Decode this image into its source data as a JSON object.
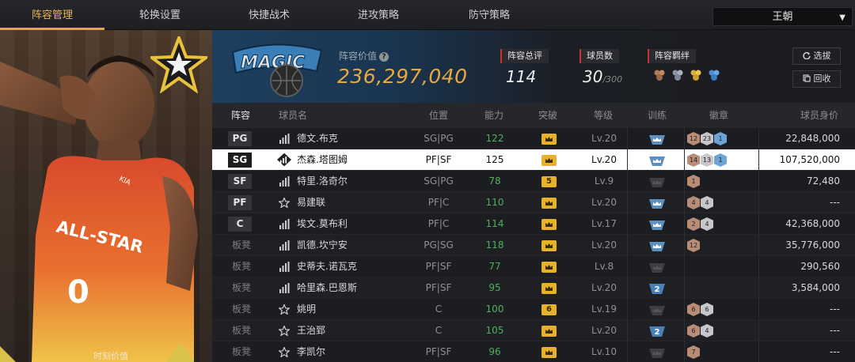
{
  "tabs": [
    {
      "label": "阵容管理",
      "active": true
    },
    {
      "label": "轮换设置",
      "active": false
    },
    {
      "label": "快捷战术",
      "active": false
    },
    {
      "label": "进攻策略",
      "active": false
    },
    {
      "label": "防守策略",
      "active": false
    }
  ],
  "team_select": {
    "value": "王朝"
  },
  "hero": {
    "caption": "时刻价值",
    "player_number": "0",
    "jersey_text": "ALL-STAR"
  },
  "team": {
    "logo_text": "MAGIC",
    "value_label": "阵容价值",
    "value": "236,297,040",
    "overall_label": "阵容总评",
    "overall": "114",
    "count_label": "球员数",
    "count": "30",
    "count_max": "/300",
    "bond_label": "阵容羁绊",
    "bond_icons": [
      "bond-bronze-icon",
      "bond-silver-icon",
      "bond-gold-icon",
      "bond-blue-icon"
    ]
  },
  "buttons": {
    "draft": "选拔",
    "recycle": "回收"
  },
  "columns": [
    "阵容",
    "球员名",
    "位置",
    "能力",
    "突破",
    "等级",
    "训练",
    "徽章",
    "球员身价"
  ],
  "rows": [
    {
      "slot": "PG",
      "starter": true,
      "rank": "bars",
      "name": "德文.布克",
      "pos": "SG|PG",
      "ability": "122",
      "brk": "crown",
      "level": "Lv.20",
      "train": "blue",
      "badges": [
        [
          "12",
          "bronze"
        ],
        [
          "23",
          "silver"
        ],
        [
          "1",
          "blue"
        ]
      ],
      "salary": "22,848,000"
    },
    {
      "slot": "SG",
      "starter": true,
      "rank": "bars",
      "name": "杰森.塔图姆",
      "pos": "PF|SF",
      "ability": "125",
      "brk": "crown",
      "level": "Lv.20",
      "train": "blue",
      "badges": [
        [
          "14",
          "bronze"
        ],
        [
          "13",
          "silver"
        ],
        [
          "1",
          "blue"
        ]
      ],
      "salary": "107,520,000"
    },
    {
      "slot": "SF",
      "starter": true,
      "rank": "bars",
      "name": "特里.洛奇尔",
      "pos": "SG|PG",
      "ability": "78",
      "brk": "5",
      "level": "Lv.9",
      "train": "grey",
      "badges": [
        [
          "1",
          "bronze"
        ]
      ],
      "salary": "72,480"
    },
    {
      "slot": "PF",
      "starter": true,
      "rank": "star",
      "name": "易建联",
      "pos": "PF|C",
      "ability": "110",
      "brk": "crown",
      "level": "Lv.20",
      "train": "blue",
      "badges": [
        [
          "4",
          "bronze"
        ],
        [
          "4",
          "silver"
        ]
      ],
      "salary": "---"
    },
    {
      "slot": "C",
      "starter": true,
      "rank": "bars",
      "name": "埃文.莫布利",
      "pos": "PF|C",
      "ability": "114",
      "brk": "crown",
      "level": "Lv.17",
      "train": "blue",
      "badges": [
        [
          "2",
          "bronze"
        ],
        [
          "4",
          "silver"
        ]
      ],
      "salary": "42,368,000"
    },
    {
      "slot": "板凳",
      "starter": false,
      "rank": "bars",
      "name": "凯德.坎宁安",
      "pos": "PG|SG",
      "ability": "118",
      "brk": "crown",
      "level": "Lv.20",
      "train": "blue",
      "badges": [
        [
          "12",
          "bronze"
        ]
      ],
      "salary": "35,776,000"
    },
    {
      "slot": "板凳",
      "starter": false,
      "rank": "bars",
      "name": "史蒂夫.诺瓦克",
      "pos": "PF|SF",
      "ability": "77",
      "brk": "crown",
      "level": "Lv.8",
      "train": "grey",
      "badges": [],
      "salary": "290,560"
    },
    {
      "slot": "板凳",
      "starter": false,
      "rank": "bars",
      "name": "哈里森.巴恩斯",
      "pos": "PF|SF",
      "ability": "95",
      "brk": "crown",
      "level": "Lv.20",
      "train": "2",
      "badges": [],
      "salary": "3,584,000"
    },
    {
      "slot": "板凳",
      "starter": false,
      "rank": "star",
      "name": "姚明",
      "pos": "C",
      "ability": "100",
      "brk": "6",
      "level": "Lv.19",
      "train": "grey",
      "badges": [
        [
          "6",
          "bronze"
        ],
        [
          "6",
          "silver"
        ]
      ],
      "salary": "---"
    },
    {
      "slot": "板凳",
      "starter": false,
      "rank": "star",
      "name": "王治郅",
      "pos": "C",
      "ability": "105",
      "brk": "crown",
      "level": "Lv.20",
      "train": "2",
      "badges": [
        [
          "6",
          "bronze"
        ],
        [
          "4",
          "silver"
        ]
      ],
      "salary": "---"
    },
    {
      "slot": "板凳",
      "starter": false,
      "rank": "star",
      "name": "李凯尔",
      "pos": "PF|SF",
      "ability": "96",
      "brk": "crown",
      "level": "Lv.10",
      "train": "grey",
      "badges": [
        [
          "7",
          "bronze"
        ]
      ],
      "salary": "---"
    }
  ],
  "colors": {
    "accent": "#e0a83d",
    "ability_green": "#4fb05a",
    "selected_row": "#ffffff",
    "badge_blue": "#6ea4d4"
  }
}
